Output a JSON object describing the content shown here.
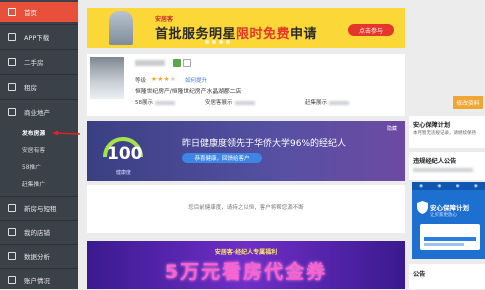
{
  "sidebar": {
    "items": [
      {
        "label": "首页",
        "active": true
      },
      {
        "label": "APP下载"
      },
      {
        "label": "二手房"
      },
      {
        "label": "租房"
      },
      {
        "label": "商业地产"
      },
      {
        "label": "新房与短租"
      },
      {
        "label": "我的店铺"
      },
      {
        "label": "数据分析"
      },
      {
        "label": "账户情况"
      }
    ],
    "sub_items": [
      {
        "label": "发布房源",
        "selected": true
      },
      {
        "label": "安居有客"
      },
      {
        "label": "58推广"
      },
      {
        "label": "赶集推广"
      }
    ]
  },
  "banner": {
    "brand": "安居客",
    "title_prefix": "首批服务明星",
    "title_highlight": "限时免费",
    "title_suffix": "申请",
    "cta_label": "点击参与"
  },
  "profile": {
    "level_label": "等级",
    "rating": 3,
    "rating_max": 5,
    "upgrade_label": "如何提升",
    "address": "恒隆世纪房产/恒隆世纪房产水晶湖郡二店",
    "stats": [
      {
        "label": "58展示"
      },
      {
        "label": "安居客展示"
      },
      {
        "label": "赶集展示"
      }
    ],
    "edit_button": "修改资料"
  },
  "health": {
    "tag": "隐藏",
    "score": "100",
    "score_label": "健康度",
    "headline": "昨日健康度领先于华侨大学96%的经纪人",
    "sub_pill": "恭喜健康，回馈给客户"
  },
  "empty_box": {
    "message": "您目前健康度，请持之以恒，客户将帮您源不断"
  },
  "promo": {
    "top_text": "安居客·经纪人专属福利",
    "big_text": "5万元看房代金券"
  },
  "right_panel": {
    "security_title": "安心保障计划",
    "security_desc": "本月暂无违规记录，请继续保持",
    "violation_title": "违规经纪人公告",
    "ad_tabs": [
      "◉",
      "◉",
      "◉",
      "◉"
    ],
    "ad_brand": "安心保障计划",
    "ad_sub": "让买家更放心",
    "notice_title": "公告"
  },
  "colors": {
    "sidebar_bg": "#3b4149",
    "active_red": "#e8503a",
    "banner_yellow": "#fbd837",
    "health_purple": "#4a4792",
    "edit_orange": "#f0a534"
  }
}
